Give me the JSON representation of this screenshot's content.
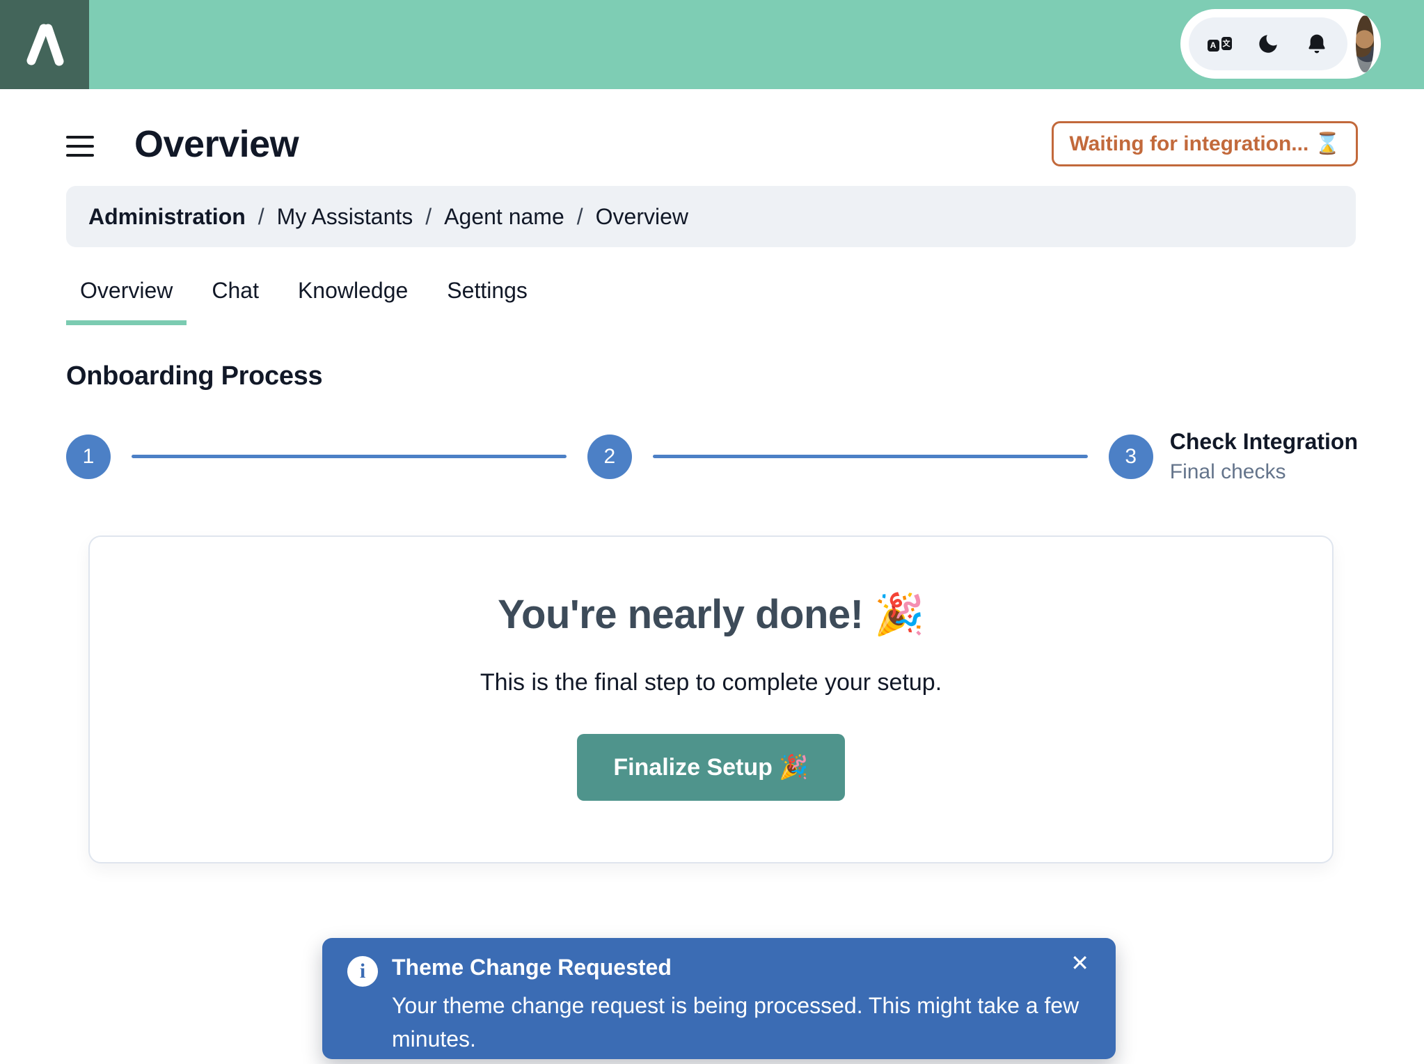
{
  "header": {
    "logo_name": "brand-lambda-logo",
    "translate_a": "A",
    "translate_char": "文"
  },
  "page": {
    "title": "Overview",
    "status_badge": "Waiting for integration... ⌛"
  },
  "breadcrumb": {
    "separator": "/",
    "items": [
      {
        "label": "Administration"
      },
      {
        "label": "My Assistants"
      },
      {
        "label": "Agent name"
      },
      {
        "label": "Overview"
      }
    ]
  },
  "tabs": [
    {
      "label": "Overview"
    },
    {
      "label": "Chat"
    },
    {
      "label": "Knowledge"
    },
    {
      "label": "Settings"
    }
  ],
  "onboarding": {
    "heading": "Onboarding Process",
    "steps": [
      {
        "number": "1"
      },
      {
        "number": "2"
      },
      {
        "number": "3",
        "title": "Check Integration",
        "subtitle": "Final checks"
      }
    ]
  },
  "card": {
    "heading": "You're nearly done! 🎉",
    "subtext": "This is the final step to complete your setup.",
    "button_label": "Finalize Setup 🎉"
  },
  "toast": {
    "info_glyph": "i",
    "title": "Theme Change Requested",
    "message": "Your theme change request is being processed. This might take a few minutes.",
    "close_glyph": "✕"
  },
  "colors": {
    "header_green": "#7ECDB4",
    "logo_dark_green": "#43655A",
    "badge_orange": "#C2693B",
    "tab_underline_green": "#7BCBB1",
    "stepper_blue": "#4C80C6",
    "button_teal": "#4F948C",
    "toast_blue": "#3B6CB4"
  }
}
